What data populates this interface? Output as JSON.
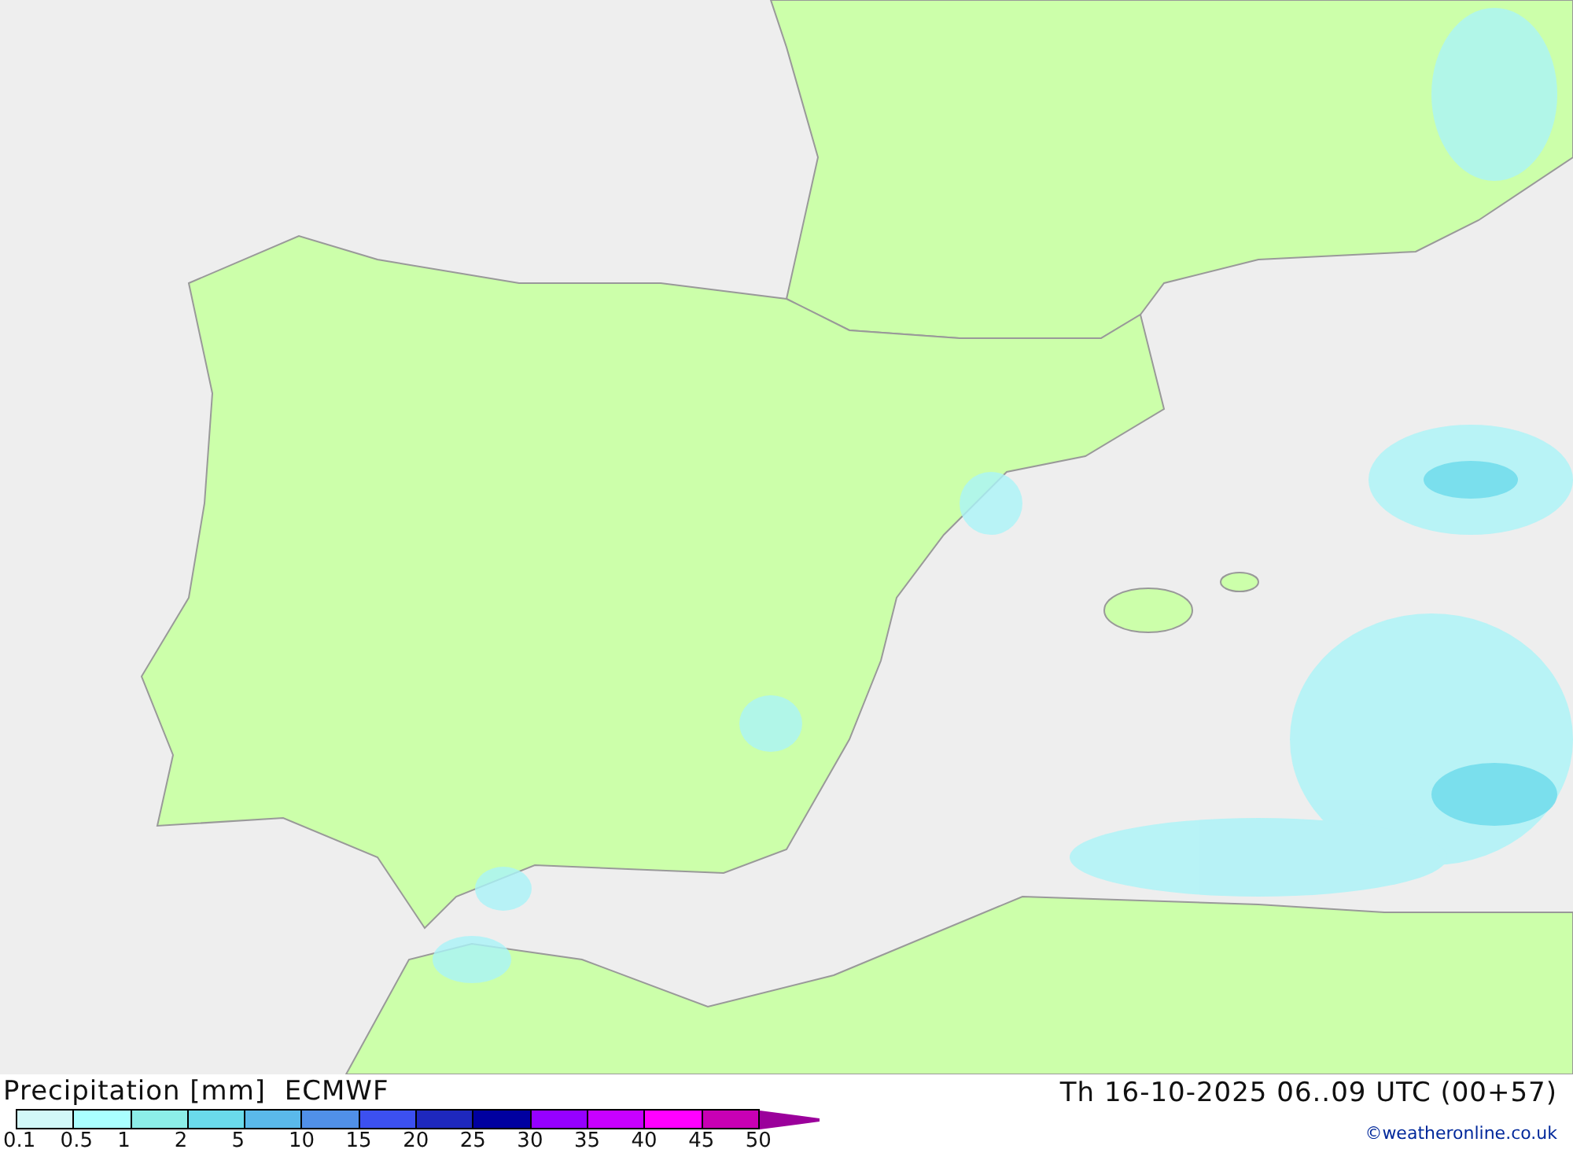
{
  "title": "Precipitation [mm]  ECMWF",
  "valid_time": "Th 16-10-2025 06..09 UTC (00+57)",
  "legend": {
    "swatches": [
      {
        "color": "#d2f8f8"
      },
      {
        "color": "#aaffff"
      },
      {
        "color": "#8ceee8"
      },
      {
        "color": "#6adaeb"
      },
      {
        "color": "#5ab9ea"
      },
      {
        "color": "#5090e8"
      },
      {
        "color": "#3c50f0"
      },
      {
        "color": "#1e28be"
      },
      {
        "color": "#0000a0"
      },
      {
        "color": "#9600ff"
      },
      {
        "color": "#c800ff"
      },
      {
        "color": "#ff00ff"
      },
      {
        "color": "#c800b4"
      }
    ],
    "labels": [
      "0.1",
      "0.5",
      "1",
      "2",
      "5",
      "10",
      "15",
      "20",
      "25",
      "30",
      "35",
      "40",
      "45",
      "50"
    ]
  },
  "credit": "©weatheronline.co.uk"
}
